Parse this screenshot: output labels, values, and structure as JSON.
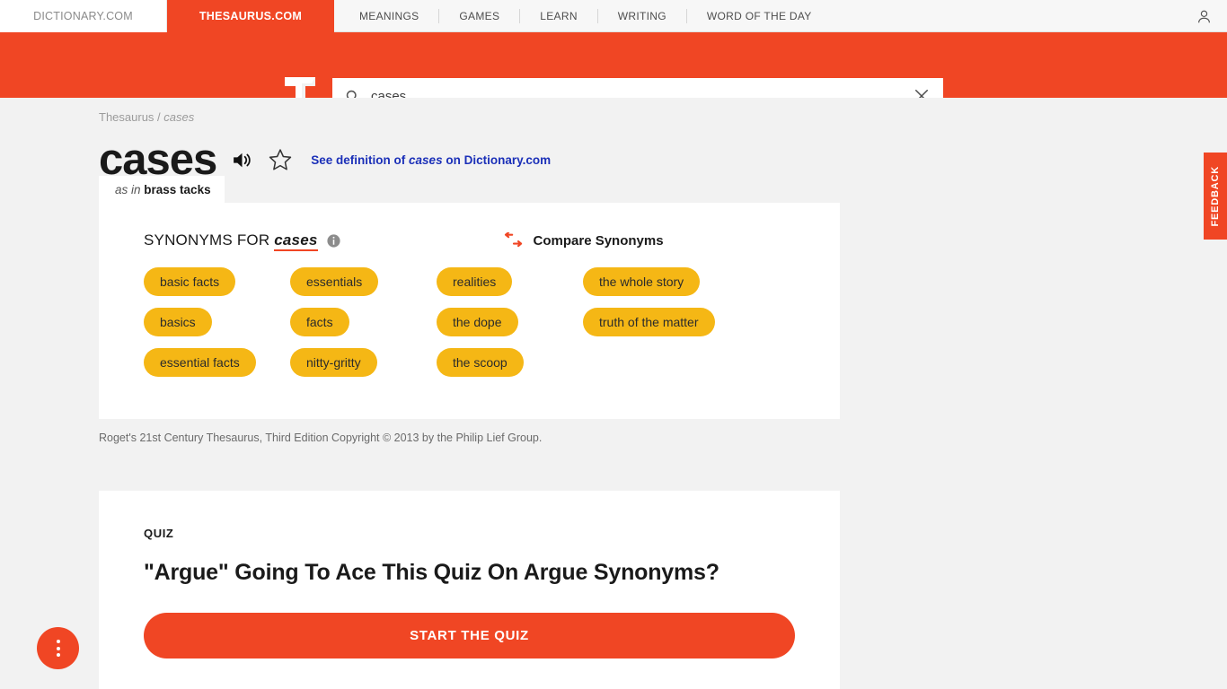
{
  "topnav": {
    "site_tabs": [
      {
        "label": "DICTIONARY.COM",
        "active": false
      },
      {
        "label": "THESAURUS.COM",
        "active": true
      }
    ],
    "links": [
      "MEANINGS",
      "GAMES",
      "LEARN",
      "WRITING",
      "WORD OF THE DAY"
    ],
    "account_icon": "account-person-icon"
  },
  "search": {
    "logo": "thesaurus-t-logo",
    "search_icon": "search-icon",
    "value": "cases",
    "placeholder": "",
    "clear_icon": "close-x-icon"
  },
  "breadcrumb": {
    "root": "Thesaurus",
    "separator": "/",
    "current": "cases"
  },
  "headline": {
    "word": "cases",
    "audio_icon": "speaker-audio-icon",
    "favorite_icon": "star-outline-icon",
    "definition_link_pre": "See definition of ",
    "definition_link_word": "cases",
    "definition_link_post": " on Dictionary.com"
  },
  "sense_tab": {
    "as_in": "as in ",
    "phrase": "brass tacks"
  },
  "synonyms_panel": {
    "title_pre": "SYNONYMS FOR ",
    "title_word": "cases",
    "info_icon": "info-circle-icon",
    "compare_icon": "compare-arrows-icon",
    "compare_label": "Compare Synonyms",
    "columns": [
      [
        "basic facts",
        "basics",
        "essential facts"
      ],
      [
        "essentials",
        "facts",
        "nitty-gritty"
      ],
      [
        "realities",
        "the dope",
        "the scoop"
      ],
      [
        "the whole story",
        "truth of the matter"
      ]
    ]
  },
  "copyright": "Roget's 21st Century Thesaurus, Third Edition Copyright © 2013 by the Philip Lief Group.",
  "quiz": {
    "kicker": "QUIZ",
    "title": "\"Argue\" Going To Ace This Quiz On Argue Synonyms?",
    "button": "START THE QUIZ"
  },
  "feedback": {
    "label": "FEEDBACK"
  },
  "fab": {
    "icon": "kebab-menu-icon"
  },
  "colors": {
    "brand_orange": "#f04624",
    "shadow_red": "#c21a09",
    "chip_amber": "#f5b715",
    "link_blue": "#1b30b8",
    "page_bg": "#f2f2f2"
  }
}
